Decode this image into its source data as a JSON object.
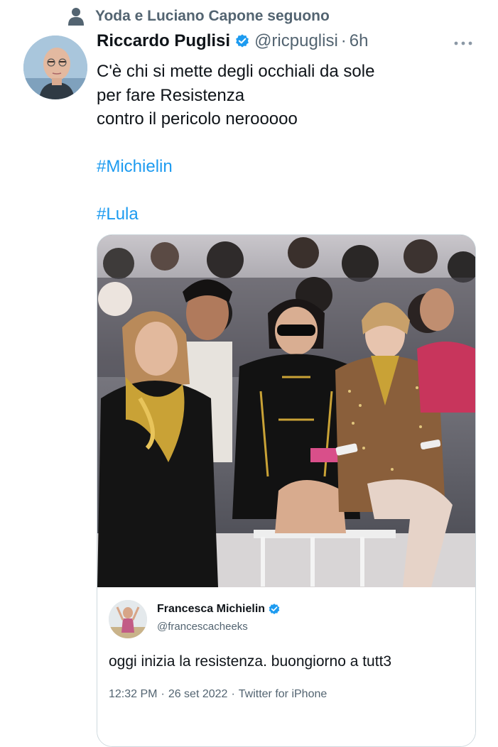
{
  "social_context": {
    "icon": "person-icon",
    "text": "Yoda e Luciano Capone seguono"
  },
  "tweet": {
    "author": {
      "name": "Riccardo Puglisi",
      "handle": "@ricpuglisi",
      "verified": true
    },
    "separator": "·",
    "time": "6h",
    "more_icon": "more-icon",
    "text_lines": [
      "C'è chi si mette degli occhiali da sole",
      "per fare Resistenza",
      "contro il pericolo nerooooo"
    ],
    "hashtags": [
      "#Michielin",
      "#Lula"
    ]
  },
  "quoted_tweet": {
    "author": {
      "name": "Francesca Michielin",
      "handle": "@francescacheeks",
      "verified": true
    },
    "text": "oggi inizia la resistenza. buongiorno a tutt3",
    "time": "12:32 PM",
    "meta_separator": "·",
    "date": "26 set 2022",
    "source": "Twitter for iPhone"
  },
  "colors": {
    "link": "#1d9bf0",
    "secondary_text": "#536471",
    "primary_text": "#0f1419",
    "verified": "#1d9bf0",
    "border": "#cfd9de"
  }
}
